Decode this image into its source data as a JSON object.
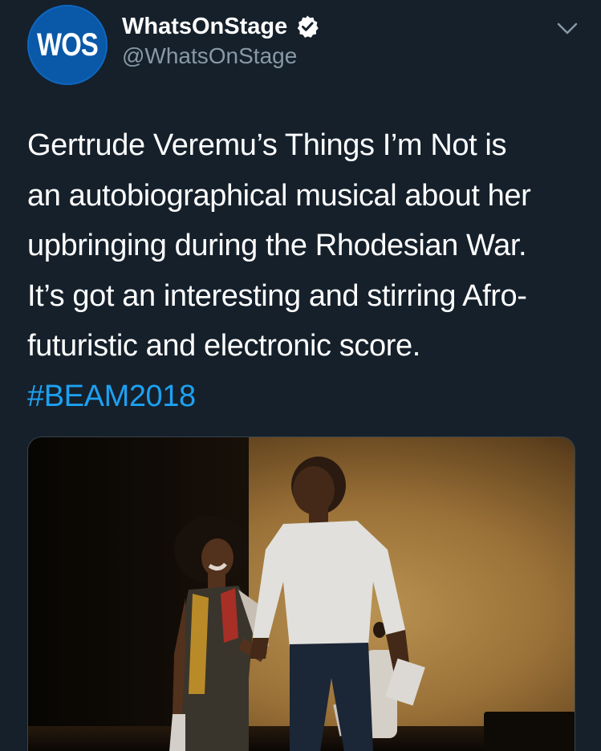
{
  "tweet": {
    "avatar_text": "WOS",
    "display_name": "WhatsOnStage",
    "handle": "@WhatsOnStage",
    "text_lines": [
      "Gertrude Veremu’s Things I’m Not is",
      "an autobiographical musical about her",
      "upbringing during the Rhodesian War.",
      "It’s got an interesting and stirring Afro-",
      "futuristic and electronic score."
    ],
    "hashtag": "#BEAM2018"
  },
  "icons": {
    "verified": "verified-badge-icon",
    "menu": "chevron-down-icon"
  },
  "colors": {
    "background": "#15202b",
    "text": "#ffffff",
    "secondary_text": "#8899a6",
    "link": "#1da1f2",
    "avatar_bg": "#0a58a8"
  }
}
